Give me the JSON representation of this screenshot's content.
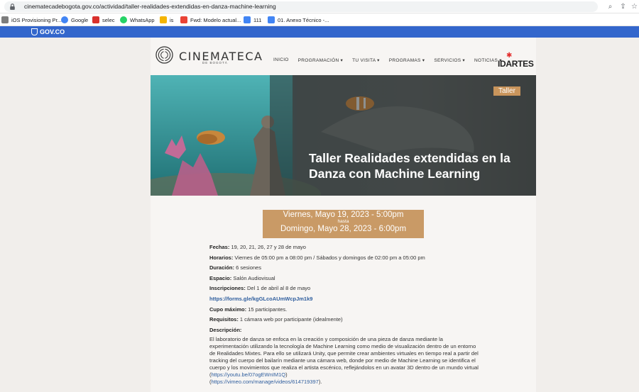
{
  "browser": {
    "url": "cinematecadebogota.gov.co/actividad/taller-realidades-extendidas-en-danza-machine-learning"
  },
  "bookmarks": [
    {
      "label": "iOS Provisioning Pr...",
      "color": "#7d7d7d"
    },
    {
      "label": "Google",
      "color": "#4285f4"
    },
    {
      "label": "selec",
      "color": "#d9302c"
    },
    {
      "label": "WhatsApp",
      "color": "#25d366"
    },
    {
      "label": "is",
      "color": "#f4b400"
    },
    {
      "label": "Fwd: Modelo actual...",
      "color": "#ea4335"
    },
    {
      "label": "111",
      "color": "#4285f4"
    },
    {
      "label": "01. Anexo Técnico -...",
      "color": "#4285f4"
    }
  ],
  "gov": {
    "label": "GOV.CO"
  },
  "site": {
    "logo": "CINEMATECA",
    "logo_sub": "DE BOGOTÁ",
    "nav": [
      "INICIO",
      "PROGRAMACIÓN ▾",
      "TU VISITA ▾",
      "PROGRAMAS ▾",
      "SERVICIOS ▾",
      "NOTICIAS ▾"
    ],
    "partner": "IDARTES"
  },
  "hero": {
    "badge": "Taller",
    "title": "Taller Realidades extendidas en la Danza con Machine Learning"
  },
  "dates": {
    "start": "Viernes, Mayo 19, 2023 - 5:00pm",
    "separator": "hasta",
    "end": "Domingo, Mayo 28, 2023 - 6:00pm"
  },
  "details": {
    "fechas_label": "Fechas:",
    "fechas": " 19, 20, 21, 26, 27 y 28 de mayo",
    "horarios_label": "Horarios:",
    "horarios": " Viernes de 05:00 pm a 08:00 pm / Sábados y domingos de 02:00 pm a 05:00 pm",
    "duracion_label": "Duración:",
    "duracion": " 6 sesiones",
    "espacio_label": "Espacio:",
    "espacio": " Salón Audiovisual",
    "inscripciones_label": "Inscripciones:",
    "inscripciones": " Del 1 de abril al 8 de mayo",
    "form_link": "https://forms.gle/kgGLcoAUmWcpJm1k9",
    "cupo_label": "Cupo máximo:",
    "cupo": " 15 participantes.",
    "requisitos_label": "Requisitos:",
    "requisitos": " 1 cámara web por participante (idealmente)",
    "descripcion_label": "Descripción:",
    "descripcion": "El laboratorio de danza se enfoca en la creación y composición de una pieza de danza mediante la experimentación utilizando la tecnología de Machine Learning como medio de visualización dentro de un entorno de Realidades Mixtes. Para ello se utilizará Unity, que permite crear ambientes virtuales en tiempo real a partir del tracking del cuerpo del bailarín mediante una cámara web, donde por medio de Machine Learning se identifica el cuerpo y los movimientos que realiza el artista escénico, reflejándolos en un avatar 3D dentro de un mundo virtual (",
    "youtube_link": "https://youtu.be/07ogEWnIM1Q",
    "desc_mid": ")",
    "vimeo_link": "https://vimeo.com/manage/videos/614719397",
    "desc_end": ")."
  }
}
